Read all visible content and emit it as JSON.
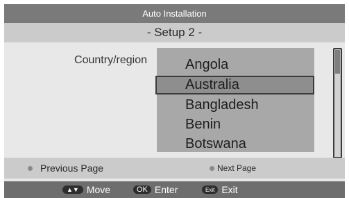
{
  "header": {
    "title": "Auto Installation",
    "subtitle": "- Setup 2 -"
  },
  "form": {
    "country_label": "Country/region",
    "countries": [
      "Angola",
      "Australia",
      "Bangladesh",
      "Benin",
      "Botswana"
    ],
    "selected_index": 1
  },
  "nav": {
    "previous_label": "Previous Page",
    "next_label": "Next Page"
  },
  "hints": {
    "move_key": "▲▼",
    "move_label": "Move",
    "enter_key": "OK",
    "enter_label": "Enter",
    "exit_key": "Exit",
    "exit_label": "Exit"
  },
  "colors": {
    "title_bar": "#7a7a7a",
    "hint_bar": "#6e6e6e",
    "list_bg": "#a8a8a8",
    "selected_border": "#3b3b3b"
  }
}
